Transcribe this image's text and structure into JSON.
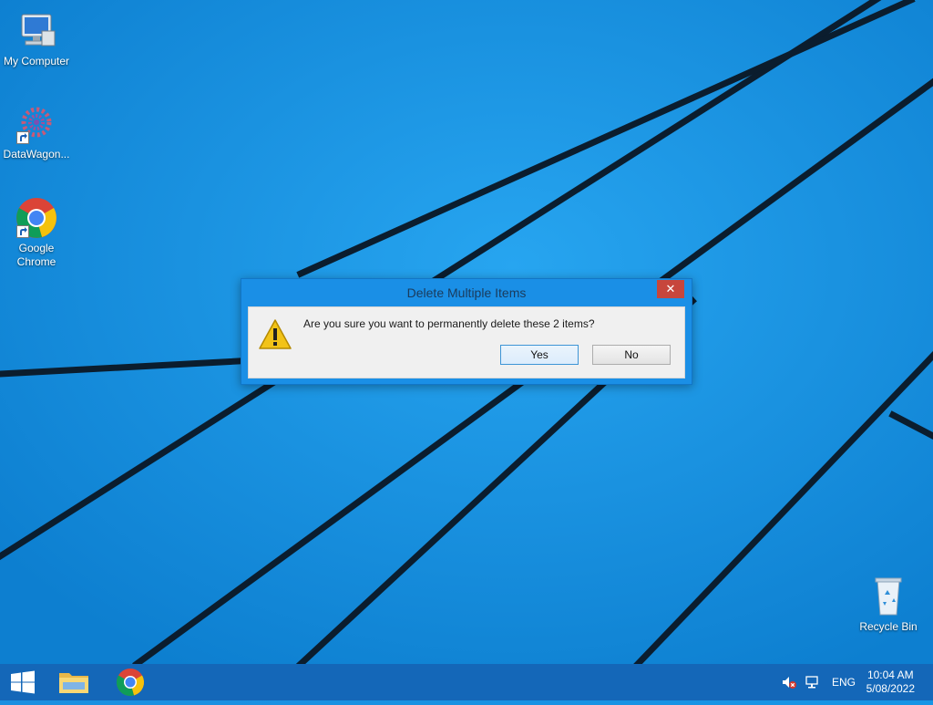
{
  "desktop": {
    "icons": [
      {
        "label": "My Computer",
        "icon": "computer-icon"
      },
      {
        "label": "DataWagon...",
        "icon": "gear-cluster-icon"
      },
      {
        "label": "Google Chrome",
        "icon": "chrome-icon"
      },
      {
        "label": "Recycle Bin",
        "icon": "recycle-bin-icon"
      }
    ]
  },
  "dialog": {
    "title": "Delete Multiple Items",
    "close_label": "✕",
    "message": "Are you sure you want to permanently delete these 2 items?",
    "yes_label": "Yes",
    "no_label": "No",
    "icon": "warning-icon"
  },
  "taskbar": {
    "start_icon": "windows-logo-icon",
    "pinned": [
      "file-explorer-icon",
      "chrome-icon"
    ],
    "tray": {
      "language": "ENG",
      "time": "10:04 AM",
      "date": "5/08/2022",
      "icons": [
        "volume-muted-icon",
        "network-icon"
      ]
    }
  },
  "colors": {
    "desktop": "#1596e6",
    "taskbar": "#1467b8",
    "dialog_frame": "#1a8fe6",
    "close_button": "#c7463c"
  }
}
